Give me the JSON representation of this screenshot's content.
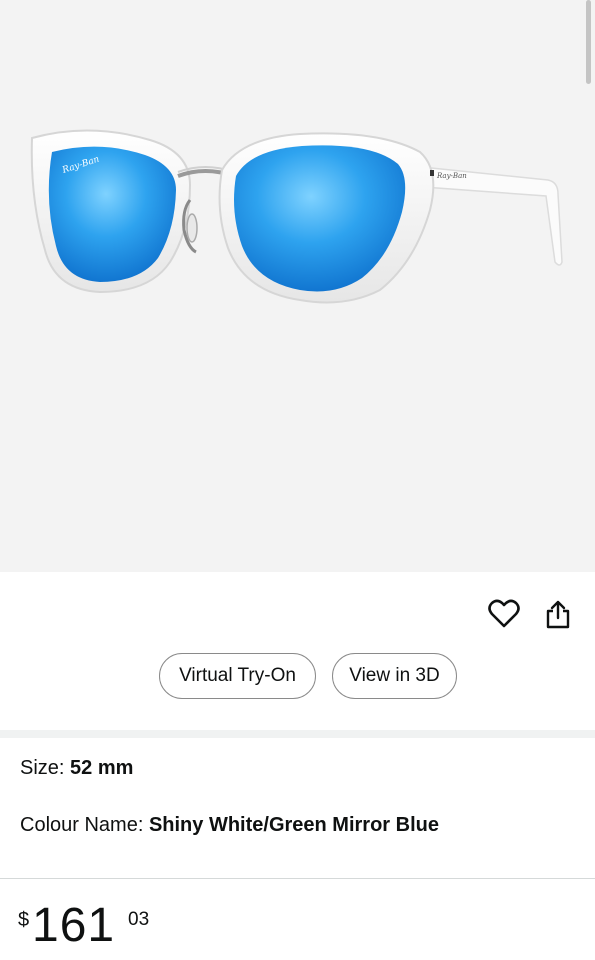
{
  "product": {
    "image_alt": "Ray-Ban sunglasses, shiny white frame with blue mirror lenses",
    "brand_mark": "Ray-Ban"
  },
  "actions": {
    "wishlist_icon": "heart-outline",
    "share_icon": "share-arrow",
    "virtual_try_on_label": "Virtual Try-On",
    "view_3d_label": "View in 3D"
  },
  "attributes": {
    "size_label": "Size: ",
    "size_value": "52 mm",
    "colour_label": "Colour Name: ",
    "colour_value": "Shiny White/Green Mirror Blue"
  },
  "price": {
    "currency": "$",
    "whole": "161",
    "fraction": "03"
  },
  "colors": {
    "hero_background": "#f3f3f3",
    "lens_blue": "#1f8fe0",
    "pill_border": "#8a8a8a",
    "divider": "#f0f2f2"
  }
}
